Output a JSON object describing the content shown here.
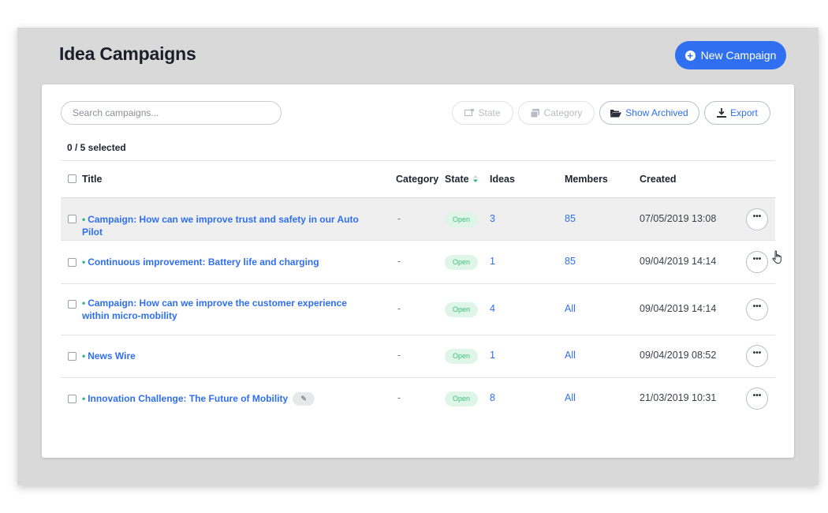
{
  "header": {
    "title": "Idea Campaigns",
    "new_button_label": "New Campaign"
  },
  "toolbar": {
    "search_placeholder": "Search campaigns...",
    "state_label": "State",
    "category_label": "Category",
    "show_archived_label": "Show Archived",
    "export_label": "Export"
  },
  "selection": {
    "count_text": "0 / 5 selected"
  },
  "table": {
    "headers": {
      "title": "Title",
      "category": "Category",
      "state": "State",
      "ideas": "Ideas",
      "members": "Members",
      "created": "Created"
    },
    "rows": [
      {
        "title": "Campaign: How can we improve trust and safety in our Auto Pilot",
        "category": "-",
        "state": "Open",
        "ideas": "3",
        "members": "85",
        "created": "07/05/2019 13:08"
      },
      {
        "title": "Continuous improvement: Battery life and charging",
        "category": "-",
        "state": "Open",
        "ideas": "1",
        "members": "85",
        "created": "09/04/2019 14:14"
      },
      {
        "title": "Campaign: How can we improve the customer experience within micro-mobility",
        "category": "-",
        "state": "Open",
        "ideas": "4",
        "members": "All",
        "created": "09/04/2019 14:14"
      },
      {
        "title": "News Wire",
        "category": "-",
        "state": "Open",
        "ideas": "1",
        "members": "All",
        "created": "09/04/2019 08:52"
      },
      {
        "title": "Innovation Challenge: The Future of Mobility",
        "category": "-",
        "state": "Open",
        "ideas": "8",
        "members": "All",
        "created": "21/03/2019 10:31"
      }
    ]
  },
  "icons": {
    "plus_circle": "plus-circle-icon",
    "state": "state-icon",
    "category": "category-icon",
    "archive": "folder-open-icon",
    "export": "download-icon",
    "sort": "sort-icon",
    "more": "more-dots-icon",
    "pin": "pin-icon",
    "cursor": "hand-pointer-icon"
  },
  "colors": {
    "accent": "#2f6ff0",
    "open_badge_text": "#3ec07c",
    "open_badge_bg": "#dff5e8",
    "status_dot": "#2bb673"
  }
}
